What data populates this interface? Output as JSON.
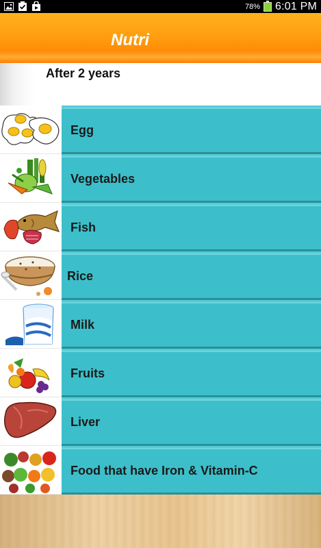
{
  "status_bar": {
    "battery_percent": "78%",
    "time": "6:01 PM",
    "icons": [
      "image-icon",
      "clipboard-check-icon",
      "shopping-bag-icon"
    ]
  },
  "header": {
    "title": "Nutri"
  },
  "subheader": {
    "text": "After 2 years"
  },
  "foods": [
    {
      "label": "Egg",
      "icon": "egg-icon"
    },
    {
      "label": "Vegetables",
      "icon": "vegetables-icon"
    },
    {
      "label": "Fish",
      "icon": "fish-icon"
    },
    {
      "label": "Rice",
      "icon": "rice-icon"
    },
    {
      "label": "Milk",
      "icon": "milk-icon"
    },
    {
      "label": "Fruits",
      "icon": "fruits-icon"
    },
    {
      "label": "Liver",
      "icon": "liver-icon"
    },
    {
      "label": "Food that have Iron & Vitamin-C",
      "icon": "iron-vitamin-c-food-icon"
    }
  ],
  "colors": {
    "header_orange": "#ff9a0c",
    "list_teal": "#3cbfca"
  }
}
